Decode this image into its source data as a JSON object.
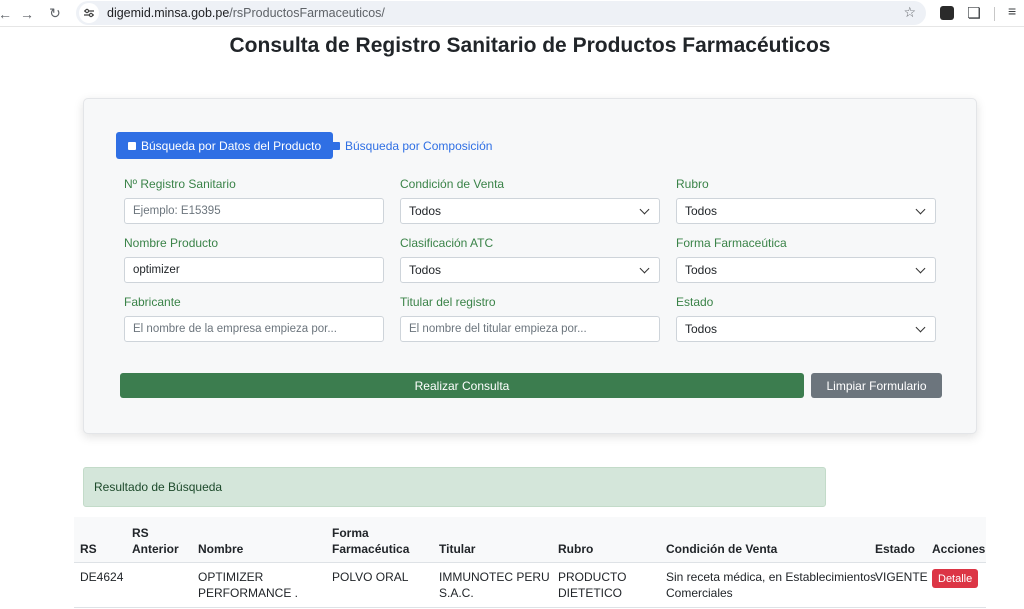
{
  "browser": {
    "url_host": "digemid.minsa.gob.pe",
    "url_path": "/rsProductosFarmaceuticos/"
  },
  "page": {
    "title": "Consulta de Registro Sanitario de Productos Farmacéuticos"
  },
  "search": {
    "tabs": [
      {
        "label": "Búsqueda por Datos del Producto",
        "active": true
      },
      {
        "label": "Búsqueda por Composición",
        "active": false
      }
    ],
    "fields": {
      "registro": {
        "label": "Nº Registro Sanitario",
        "value": "",
        "placeholder": "Ejemplo: E15395"
      },
      "condicion": {
        "label": "Condición de Venta",
        "value": "Todos"
      },
      "rubro": {
        "label": "Rubro",
        "value": "Todos"
      },
      "nombre": {
        "label": "Nombre Producto",
        "value": "optimizer"
      },
      "atc": {
        "label": "Clasificación ATC",
        "value": "Todos"
      },
      "forma": {
        "label": "Forma Farmaceútica",
        "value": "Todos"
      },
      "fabricante": {
        "label": "Fabricante",
        "value": "",
        "placeholder": "El nombre de la empresa empieza por..."
      },
      "titular": {
        "label": "Titular del registro",
        "value": "",
        "placeholder": "El nombre del titular empieza por..."
      },
      "estado": {
        "label": "Estado",
        "value": "Todos"
      }
    },
    "submit_label": "Realizar Consulta",
    "clear_label": "Limpiar Formulario"
  },
  "results": {
    "title": "Resultado de Búsqueda",
    "columns": {
      "rs": "RS",
      "rs_anterior_1": "RS",
      "rs_anterior_2": "Anterior",
      "nombre": "Nombre",
      "forma_1": "Forma",
      "forma_2": "Farmacéutica",
      "titular": "Titular",
      "rubro": "Rubro",
      "condicion": "Condición de Venta",
      "estado": "Estado",
      "acciones": "Acciones"
    },
    "rows": [
      {
        "rs": "DE4624",
        "rs_anterior": "",
        "nombre_1": "OPTIMIZER",
        "nombre_2": "PERFORMANCE .",
        "forma": "POLVO ORAL",
        "titular_1": "IMMUNOTEC PERU",
        "titular_2": "S.A.C.",
        "rubro_1": "PRODUCTO",
        "rubro_2": "DIETETICO",
        "condicion_1": "Sin receta médica, en Establecimientos",
        "condicion_2": "Comerciales",
        "estado": "VIGENTE",
        "action_label": "Detalle"
      }
    ]
  }
}
